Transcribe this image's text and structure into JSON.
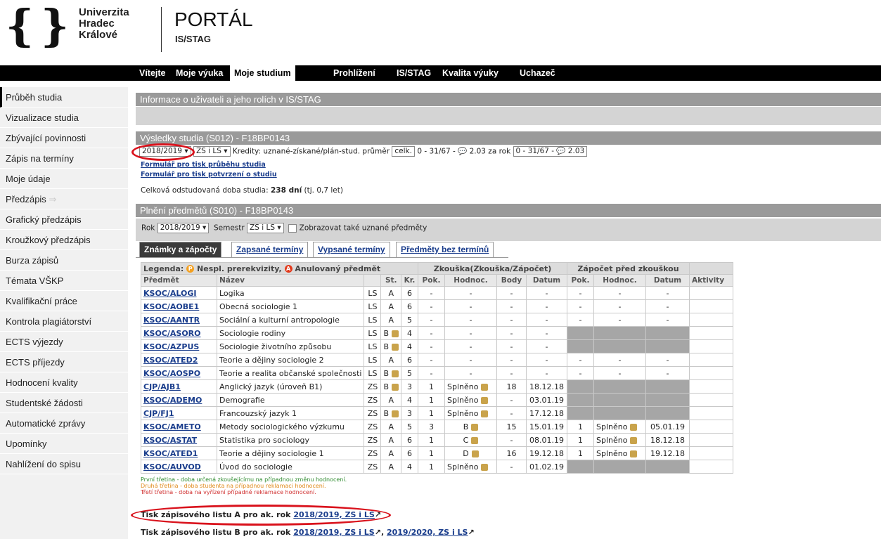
{
  "header": {
    "uni": [
      "Univerzita",
      "Hradec",
      "Králové"
    ],
    "portal": "PORTÁL",
    "portal_sub": "IS/STAG"
  },
  "topnav": [
    "Vítejte",
    "Moje výuka",
    "Moje studium",
    "Prohlížení",
    "IS/STAG",
    "Kvalita výuky",
    "Uchazeč"
  ],
  "sidebar": [
    "Průběh studia",
    "Vizualizace studia",
    "Zbývající povinnosti",
    "Zápis na termíny",
    "Moje údaje",
    "Předzápis",
    "Grafický předzápis",
    "Kroužkový předzápis",
    "Burza zápisů",
    "Témata VŠKP",
    "Kvalifikační práce",
    "Kontrola plagiátorství",
    "ECTS výjezdy",
    "ECTS příjezdy",
    "Hodnocení kvality",
    "Studentské žádosti",
    "Automatické zprávy",
    "Upomínky",
    "Nahlížení do spisu"
  ],
  "info_bar": "Informace o uživateli a jeho rolích v IS/STAG",
  "results": {
    "bar": "Výsledky studia (S012) - F18BP0143",
    "year": "2018/2019",
    "sem": "ZS i LS",
    "credits": "Kredity: uznané-získané/plán-stud. průměr",
    "celk": "celk.",
    "cr1": "0 - 31/67 - 💬 2.03 za rok",
    "cr2": "0 - 31/67 - 💬 2.03",
    "link1": "Formulář pro tisk průběhu studia",
    "link2": "Formulář pro tisk potvrzení o studiu",
    "dur_pre": "Celková odstudovaná doba studia:",
    "dur_val": "238 dní",
    "dur_post": "(tj. 0,7 let)"
  },
  "plneni": {
    "bar": "Plnění předmětů (S010) - F18BP0143",
    "rok_label": "Rok",
    "rok": "2018/2019",
    "sem_label": "Semestr",
    "sem": "ZS i LS",
    "show_label": "Zobrazovat také uznané předměty"
  },
  "tabs": [
    "Známky a zápočty",
    "Zapsané termíny",
    "Vypsané termíny",
    "Předměty bez termínů"
  ],
  "table": {
    "legend_label": "Legenda:",
    "legend_p": "Nespl. prerekvizity,",
    "legend_a": "Anulovaný předmět",
    "grp_exam": "Zkouška(Zkouška/Zápočet)",
    "grp_credit": "Zápočet před zkouškou",
    "cols": [
      "Předmět",
      "Název",
      "",
      "St.",
      "Kr.",
      "Pok.",
      "Hodnoc.",
      "Body",
      "Datum",
      "Pok.",
      "Hodnoc.",
      "Datum",
      "Aktivity"
    ],
    "rows": [
      [
        "KSOC/ALOGI",
        "Logika",
        "LS",
        "A",
        "6",
        "-",
        "-",
        "-",
        "-",
        "-",
        "-",
        "-",
        ""
      ],
      [
        "KSOC/AOBE1",
        "Obecná sociologie 1",
        "LS",
        "A",
        "6",
        "-",
        "-",
        "-",
        "-",
        "-",
        "-",
        "-",
        ""
      ],
      [
        "KSOC/AANTR",
        "Sociální a kulturní antropologie",
        "LS",
        "A",
        "5",
        "-",
        "-",
        "-",
        "-",
        "-",
        "-",
        "-",
        ""
      ],
      [
        "KSOC/ASORO",
        "Sociologie rodiny",
        "LS",
        "B",
        "4",
        "-",
        "-",
        "-",
        "-",
        "X",
        "X",
        "X",
        ""
      ],
      [
        "KSOC/AZPUS",
        "Sociologie životního způsobu",
        "LS",
        "B",
        "4",
        "-",
        "-",
        "-",
        "-",
        "X",
        "X",
        "X",
        ""
      ],
      [
        "KSOC/ATED2",
        "Teorie a dějiny sociologie 2",
        "LS",
        "A",
        "6",
        "-",
        "-",
        "-",
        "-",
        "-",
        "-",
        "-",
        ""
      ],
      [
        "KSOC/AOSPO",
        "Teorie a realita občanské společnosti",
        "LS",
        "B",
        "5",
        "-",
        "-",
        "-",
        "-",
        "-",
        "-",
        "-",
        ""
      ],
      [
        "CJP/AJB1",
        "Anglický jazyk (úroveň B1)",
        "ZS",
        "B",
        "3",
        "1",
        "Splněno",
        "18",
        "18.12.18",
        "X",
        "X",
        "X",
        ""
      ],
      [
        "KSOC/ADEMO",
        "Demografie",
        "ZS",
        "A",
        "4",
        "1",
        "Splněno",
        "-",
        "03.01.19",
        "X",
        "X",
        "X",
        ""
      ],
      [
        "CJP/FJ1",
        "Francouzský jazyk 1",
        "ZS",
        "B",
        "3",
        "1",
        "Splněno",
        "-",
        "17.12.18",
        "X",
        "X",
        "X",
        ""
      ],
      [
        "KSOC/AMETO",
        "Metody sociologického výzkumu",
        "ZS",
        "A",
        "5",
        "3",
        "B",
        "15",
        "15.01.19",
        "1",
        "Splněno",
        "05.01.19",
        ""
      ],
      [
        "KSOC/ASTAT",
        "Statistika pro sociology",
        "ZS",
        "A",
        "6",
        "1",
        "C",
        "-",
        "08.01.19",
        "1",
        "Splněno",
        "18.12.18",
        ""
      ],
      [
        "KSOC/ATED1",
        "Teorie a dějiny sociologie 1",
        "ZS",
        "A",
        "6",
        "1",
        "D",
        "16",
        "19.12.18",
        "1",
        "Splněno",
        "19.12.18",
        ""
      ],
      [
        "KSOC/AUVOD",
        "Úvod do sociologie",
        "ZS",
        "A",
        "4",
        "1",
        "Splněno",
        "-",
        "01.02.19",
        "X",
        "X",
        "X",
        ""
      ]
    ]
  },
  "notes": [
    "První třetina - doba určená zkoušejícímu na případnou změnu hodnocení.",
    "Druhá třetina - doba studenta na případnou reklamaci hodnocení.",
    "Třetí třetina - doba na vyřízení případné reklamace hodnocení."
  ],
  "printA": {
    "label": "Tisk zápisového listu A pro ak. rok",
    "link": "2018/2019, ZS i LS"
  },
  "printB": {
    "label": "Tisk zápisového listu B pro ak. rok",
    "link1": "2018/2019, ZS i LS",
    "link2": "2019/2020, ZS i LS"
  },
  "colors": {
    "nav_bg": "#000000",
    "section_bar": "#9a9a9a",
    "link": "#1a3d8c",
    "highlight_ring": "#d9121c"
  }
}
